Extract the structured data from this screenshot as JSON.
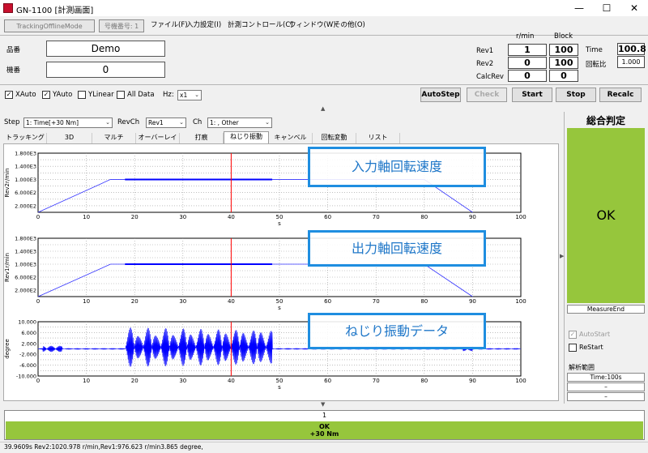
{
  "window": {
    "title": "GN-1100 [計測画面]",
    "minimize": "—",
    "maximize": "☐",
    "close": "✕"
  },
  "mode": {
    "offline": "TrackingOfflineMode",
    "machine": "号機番号: 1"
  },
  "menu": [
    "ファイル(F)",
    "入力設定(I)",
    "計測コントロール(C)",
    "ウィンドウ(W)",
    "その他(O)"
  ],
  "product": {
    "hinban_label": "品番",
    "hinban_value": "Demo",
    "kiban_label": "機番",
    "kiban_value": "0"
  },
  "readouts": {
    "rmin_header": "r/min",
    "block_header": "Block",
    "rev1_label": "Rev1",
    "rev1_rmin": "1",
    "rev1_block": "100",
    "rev2_label": "Rev2",
    "rev2_rmin": "0",
    "rev2_block": "100",
    "calcrev_label": "CalcRev",
    "calcrev_rmin": "0",
    "calcrev_block": "0",
    "time_label": "Time",
    "time_value": "100.8",
    "ratio_label": "回転比",
    "ratio_value": "1.000"
  },
  "options": {
    "xauto": "XAuto",
    "yauto": "YAuto",
    "ylinear": "YLinear",
    "alldata": "All Data",
    "hz_label": "Hz:",
    "hz_value": "x1"
  },
  "buttons": {
    "autostep": "AutoStep",
    "check": "Check",
    "start": "Start",
    "stop": "Stop",
    "recalc": "Recalc"
  },
  "selectors": {
    "step_label": "Step",
    "step_value": "1: Time[+30 Nm]",
    "revch_label": "RevCh",
    "revch_value": "Rev1",
    "ch_label": "Ch",
    "ch_value": "1: , Other"
  },
  "tabs": [
    "トラッキング",
    "3D",
    "マルチ",
    "オーバーレイ",
    "打痕",
    "ねじり振動",
    "キャンベル",
    "回転変動",
    "リスト"
  ],
  "charts": {
    "xticks": [
      "0",
      "10",
      "20",
      "30",
      "40",
      "50",
      "60",
      "70",
      "80",
      "90",
      "100"
    ],
    "xunit": "s",
    "c1": {
      "ylabel": "Rev2r/min",
      "yticks": [
        "1.800E3",
        "1.400E3",
        "1.000E3",
        "6.000E2",
        "2.000E2"
      ],
      "overlay": "入力軸回転速度"
    },
    "c2": {
      "ylabel": "Rev1r/min",
      "yticks": [
        "1.800E3",
        "1.400E3",
        "1.000E3",
        "6.000E2",
        "2.000E2"
      ],
      "overlay": "出力軸回転速度"
    },
    "c3": {
      "ylabel": "degree",
      "yticks": [
        "10.000",
        "6.000",
        "2.000",
        "-2.000",
        "-6.000",
        "-10.000"
      ],
      "overlay": "ねじり振動データ"
    }
  },
  "judgement": {
    "title": "総合判定",
    "result": "OK",
    "status": "MeasureEnd",
    "autostart": "AutoStart",
    "restart": "ReStart",
    "range_label": "解析範囲",
    "range_time": "Time:100s",
    "range_2": "–",
    "range_3": "–"
  },
  "bottom": {
    "index": "1",
    "result": "OK",
    "condition": "+30 Nm"
  },
  "statusbar": "39.9609s  Rev2:1020.978 r/min,Rev1:976.623 r/min3.865 degree,",
  "colors": {
    "accent": "#1f8ee0",
    "ok": "#96c63c",
    "trace": "#0000ff",
    "cursor": "#ff0000"
  }
}
